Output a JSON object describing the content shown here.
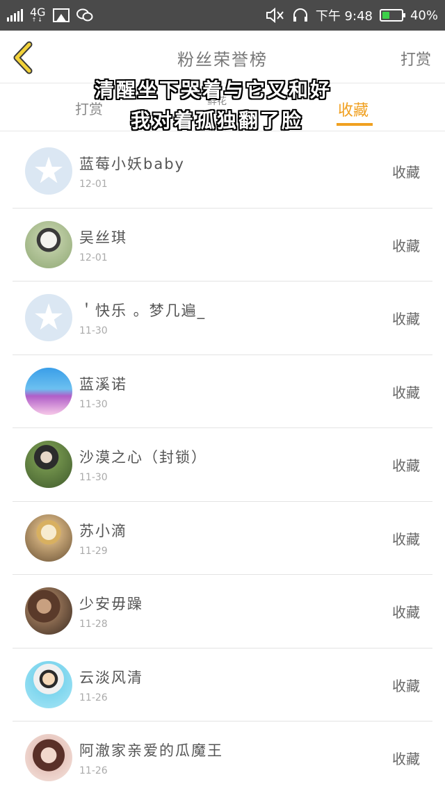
{
  "status_bar": {
    "network": "4G",
    "time": "下午 9:48",
    "battery": "40%",
    "battery_level": 0.4
  },
  "header": {
    "title": "粉丝荣誉榜",
    "action_label": "打赏"
  },
  "tabs": [
    {
      "label": "打赏",
      "active": false
    },
    {
      "label": "鲜花",
      "active": false
    },
    {
      "label": "收藏",
      "active": true
    }
  ],
  "overlay": {
    "line1": "清醒坐下哭着与它又和好",
    "line2": "我对着孤独翻了脸"
  },
  "fans": [
    {
      "name": "蓝莓小妖baby",
      "date": "12-01",
      "action": "收藏",
      "avatar": "default"
    },
    {
      "name": "吴丝琪",
      "date": "12-01",
      "action": "收藏",
      "avatar": "photo-green"
    },
    {
      "name": "＇快乐 。梦几遍_",
      "date": "11-30",
      "action": "收藏",
      "avatar": "default"
    },
    {
      "name": "蓝溪诺",
      "date": "11-30",
      "action": "收藏",
      "avatar": "photo-blue"
    },
    {
      "name": "沙漠之心（封锁）",
      "date": "11-30",
      "action": "收藏",
      "avatar": "photo-forest"
    },
    {
      "name": "苏小滴",
      "date": "11-29",
      "action": "收藏",
      "avatar": "photo-anime"
    },
    {
      "name": "少安毋躁",
      "date": "11-28",
      "action": "收藏",
      "avatar": "photo-dark"
    },
    {
      "name": "云淡风清",
      "date": "11-26",
      "action": "收藏",
      "avatar": "photo-cartoon"
    },
    {
      "name": "阿澈家亲爱的瓜魔王",
      "date": "11-26",
      "action": "收藏",
      "avatar": "photo-girl"
    }
  ],
  "colors": {
    "accent": "#f0a020",
    "status_bar": "#4a4a4a",
    "battery_fill": "#3cd04a"
  }
}
